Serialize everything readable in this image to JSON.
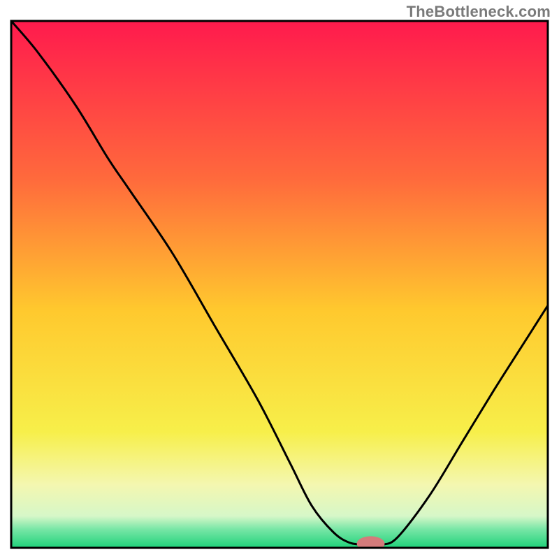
{
  "watermark": "TheBottleneck.com",
  "chart_data": {
    "type": "line",
    "title": "",
    "xlabel": "",
    "ylabel": "",
    "xlim": [
      0,
      100
    ],
    "ylim": [
      0,
      100
    ],
    "grid": false,
    "gradient_stops": [
      {
        "offset": 0.0,
        "color": "#ff1a4d"
      },
      {
        "offset": 0.3,
        "color": "#ff6a3c"
      },
      {
        "offset": 0.55,
        "color": "#ffc92e"
      },
      {
        "offset": 0.78,
        "color": "#f7ef4a"
      },
      {
        "offset": 0.88,
        "color": "#f4f7b0"
      },
      {
        "offset": 0.94,
        "color": "#d6f7c8"
      },
      {
        "offset": 0.965,
        "color": "#77e6a6"
      },
      {
        "offset": 1.0,
        "color": "#1fd27a"
      }
    ],
    "curves": [
      {
        "name": "bottleneck-curve",
        "points": [
          {
            "x": 0,
            "y": 100
          },
          {
            "x": 5,
            "y": 94
          },
          {
            "x": 12,
            "y": 84
          },
          {
            "x": 18,
            "y": 74
          },
          {
            "x": 22,
            "y": 68
          },
          {
            "x": 30,
            "y": 56
          },
          {
            "x": 38,
            "y": 42
          },
          {
            "x": 46,
            "y": 28
          },
          {
            "x": 52,
            "y": 16
          },
          {
            "x": 56,
            "y": 8
          },
          {
            "x": 60,
            "y": 3
          },
          {
            "x": 63,
            "y": 1
          },
          {
            "x": 66,
            "y": 0.6
          },
          {
            "x": 69,
            "y": 0.6
          },
          {
            "x": 72,
            "y": 2
          },
          {
            "x": 78,
            "y": 10
          },
          {
            "x": 84,
            "y": 20
          },
          {
            "x": 90,
            "y": 30
          },
          {
            "x": 95,
            "y": 38
          },
          {
            "x": 100,
            "y": 46
          }
        ]
      }
    ],
    "marker": {
      "x": 67,
      "y": 0.8,
      "color": "#d47b7b",
      "rx": 2.6,
      "ry": 1.4
    },
    "axis_box": {
      "x": 0,
      "y": 0,
      "w": 100,
      "h": 100,
      "stroke": "#000000",
      "stroke_width": 3
    }
  }
}
